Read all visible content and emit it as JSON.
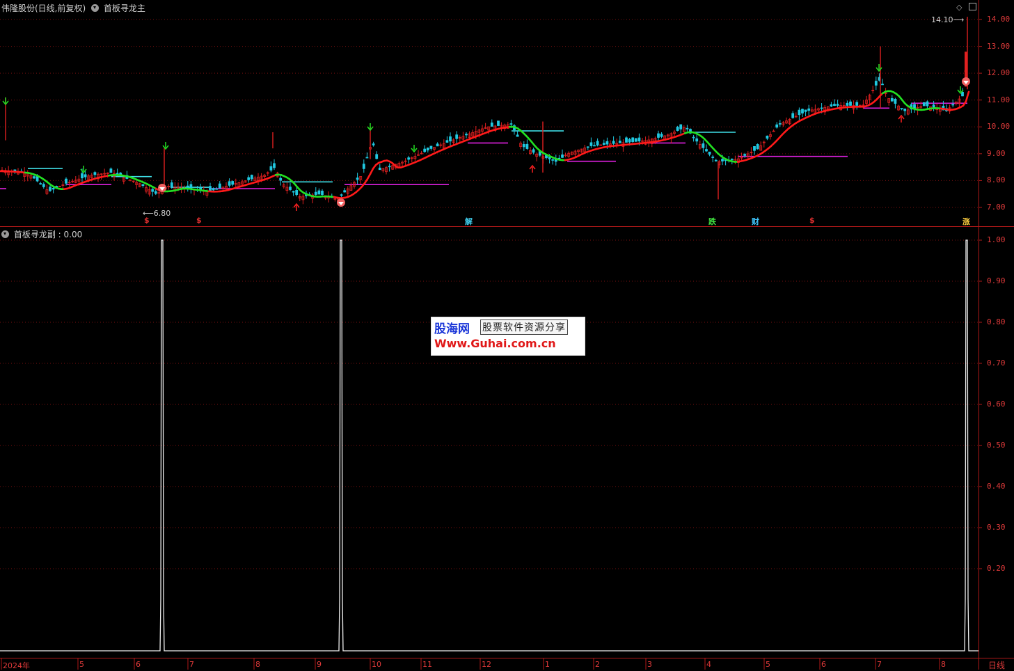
{
  "header": {
    "stock_title": "伟隆股份(日线,前复权)",
    "indicator_main": "首板寻龙主"
  },
  "sub_header": {
    "indicator_sub": "首板寻龙副 : 0.00"
  },
  "main_panel": {
    "y_labels": [
      "14.00",
      "13.00",
      "12.00",
      "11.00",
      "10.00",
      "9.00",
      "8.00",
      "7.00"
    ],
    "high_marker": "14.10",
    "low_marker": "6.80",
    "signals": [
      "$",
      "$",
      "解",
      "跌",
      "财",
      "$",
      "涨"
    ]
  },
  "sub_panel": {
    "y_labels": [
      "1.00",
      "0.90",
      "0.80",
      "0.70",
      "0.60",
      "0.50",
      "0.40",
      "0.30",
      "0.20"
    ]
  },
  "x_axis": {
    "labels": [
      "2024年",
      "5",
      "6",
      "7",
      "8",
      "9",
      "10",
      "11",
      "12",
      "1",
      "2",
      "3",
      "4",
      "5",
      "6",
      "7",
      "8"
    ],
    "period": "日线"
  },
  "watermark": {
    "brand": "股海网",
    "slogan": "股票软件资源分享",
    "url": "Www.Guhai.com.cn"
  },
  "colors": {
    "bg": "#000000",
    "axis": "#b01818",
    "up": "#e02020",
    "down": "#20c8e0",
    "ma_up": "#ff1a1a",
    "ma_down": "#22e022",
    "cyan_line": "#40e0e8",
    "magenta_line": "#e020e0"
  }
}
